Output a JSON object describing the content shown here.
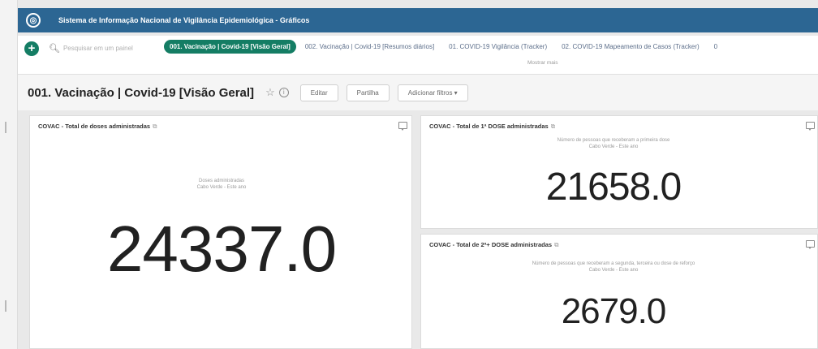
{
  "app": {
    "title": "Sistema de Informação Nacional de Vigilância Epidemiológica - Gráficos"
  },
  "search": {
    "placeholder": "Pesquisar em um painel"
  },
  "tabs": [
    {
      "label": "001. Vacinação | Covid-19 [Visão Geral]",
      "active": true
    },
    {
      "label": "002. Vacinação | Covid-19 [Resumos diários]"
    },
    {
      "label": "01. COVID-19 Vigilância (Tracker)"
    },
    {
      "label": "02. COVID-19 Mapeamento de Casos (Tracker)"
    },
    {
      "label": "0"
    }
  ],
  "show_more": "Mostrar mais",
  "dashboard": {
    "title": "001. Vacinação | Covid-19 [Visão Geral]",
    "edit_label": "Editar",
    "share_label": "Partilha",
    "filter_label": "Adicionar filtros ▾"
  },
  "cards": {
    "total_doses": {
      "title": "COVAC - Total de doses administradas",
      "subtitle_line1": "Doses administradas",
      "subtitle_line2": "Cabo Verde - Este ano",
      "value": "24337.0"
    },
    "first_dose": {
      "title": "COVAC - Total de 1ª DOSE administradas",
      "subtitle_line1": "Número de pessoas que receberam a primeira dose",
      "subtitle_line2": "Cabo Verde - Este ano",
      "value": "21658.0"
    },
    "second_dose": {
      "title": "COVAC - Total de 2ª+ DOSE administradas",
      "subtitle_line1": "Número de pessoas que receberam a segunda, terceira ou dose de reforço",
      "subtitle_line2": "Cabo Verde - Este ano",
      "value": "2679.0"
    }
  },
  "colors": {
    "header": "#2c6693",
    "accent": "#147d64"
  },
  "icons": {
    "logo": "globe-icon",
    "add": "plus-icon",
    "search": "search-icon",
    "star": "star-icon",
    "info": "info-icon",
    "comment": "comment-icon",
    "external": "external-link-icon"
  }
}
